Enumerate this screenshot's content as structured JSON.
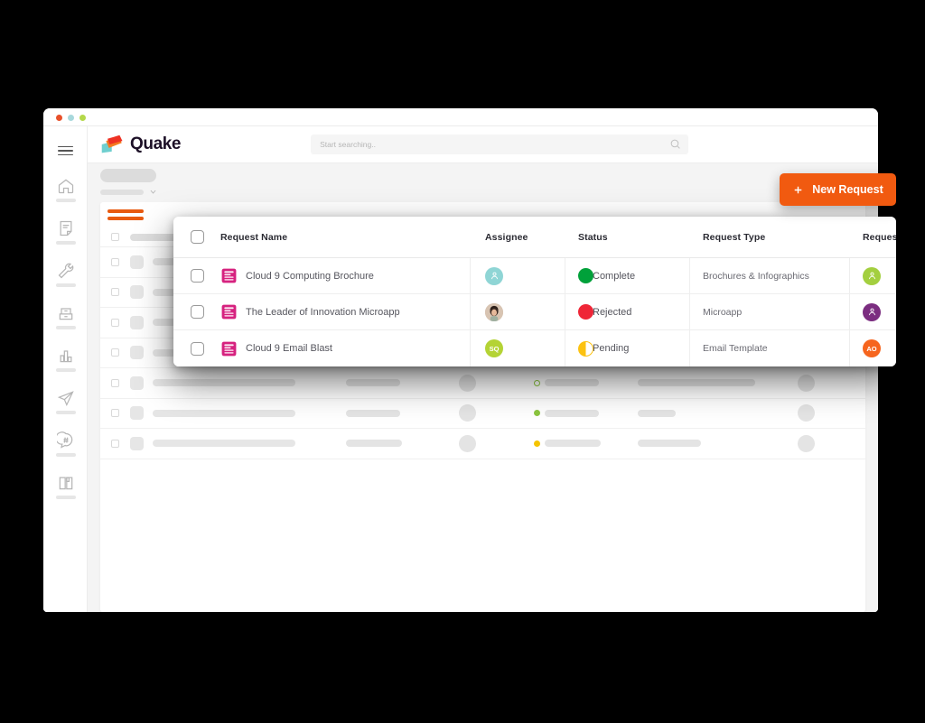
{
  "window": {
    "dots": [
      "close-dot",
      "minimize-dot",
      "maximize-dot"
    ]
  },
  "brand": {
    "name": "Quake",
    "logo_colors": {
      "red": "#ee3124",
      "orange": "#f47b20",
      "teal": "#6fcfcf"
    }
  },
  "search": {
    "placeholder": "Start searching..",
    "value": ""
  },
  "toolbar": {
    "new_request_label": "New Request",
    "new_request_color": "#f15a10",
    "plus_icon": "plus-icon"
  },
  "sidebar": {
    "items": [
      {
        "icon": "hamburger-menu-icon",
        "label": ""
      },
      {
        "icon": "home-icon",
        "label": ""
      },
      {
        "icon": "note-icon",
        "label": ""
      },
      {
        "icon": "wrench-icon",
        "label": ""
      },
      {
        "icon": "file-cabinet-icon",
        "label": ""
      },
      {
        "icon": "bar-chart-icon",
        "label": ""
      },
      {
        "icon": "paper-plane-icon",
        "label": ""
      },
      {
        "icon": "chat-bubble-icon",
        "label": ""
      },
      {
        "icon": "book-icon",
        "label": ""
      }
    ]
  },
  "table": {
    "columns": [
      "Request Name",
      "Assignee",
      "Status",
      "Request Type",
      "Requestor"
    ],
    "select_all_checkbox": "unchecked",
    "rows": [
      {
        "checkbox": "unchecked",
        "icon": "document-icon",
        "name": "Cloud 9 Computing Brochure",
        "assignee": {
          "type": "icon",
          "initials": "",
          "color": "#8fd5d5"
        },
        "status": {
          "label": "Complete",
          "color": "#00a13a",
          "fill": "full"
        },
        "request_type": "Brochures & Infographics",
        "requestor": {
          "type": "icon",
          "initials": "",
          "color": "#a3cf3f"
        }
      },
      {
        "checkbox": "unchecked",
        "icon": "document-icon",
        "name": "The Leader of Innovation Microapp",
        "assignee": {
          "type": "photo",
          "initials": "",
          "color": "#c9b6a8"
        },
        "status": {
          "label": "Rejected",
          "color": "#ef2637",
          "fill": "full"
        },
        "request_type": "Microapp",
        "requestor": {
          "type": "icon",
          "initials": "",
          "color": "#7b2d80"
        }
      },
      {
        "checkbox": "unchecked",
        "icon": "document-icon",
        "name": "Cloud 9 Email Blast",
        "assignee": {
          "type": "initials",
          "initials": "SQ",
          "color": "#b4d335"
        },
        "status": {
          "label": "Pending",
          "color": "#fcc211",
          "fill": "half"
        },
        "request_type": "Email Template",
        "requestor": {
          "type": "initials",
          "initials": "AO",
          "color": "#f6651e"
        }
      }
    ]
  },
  "skeleton": {
    "header": {
      "checkbox": "unchecked"
    },
    "rows": [
      {
        "status_dot": {
          "color": "#8cc63f",
          "style": "ring"
        },
        "name_w": 158,
        "asg_w": 62,
        "st_w": 62,
        "type_w": 98
      },
      {
        "status_dot": {
          "color": "#e8401a",
          "style": "solid"
        },
        "name_w": 155,
        "asg_w": 60,
        "st_w": 60,
        "type_w": 45
      },
      {
        "status_dot": {
          "color": "#f5c400",
          "style": "solid"
        },
        "name_w": 155,
        "asg_w": 62,
        "st_w": 62,
        "type_w": 125
      },
      {
        "status_dot": {
          "color": "#e8401a",
          "style": "solid"
        },
        "name_w": 158,
        "asg_w": 62,
        "st_w": 62,
        "type_w": 88
      },
      {
        "status_dot": {
          "color": "#8cc63f",
          "style": "ring"
        },
        "name_w": 158,
        "asg_w": 60,
        "st_w": 60,
        "type_w": 130
      },
      {
        "status_dot": {
          "color": "#8cc63f",
          "style": "solid"
        },
        "name_w": 158,
        "asg_w": 60,
        "st_w": 60,
        "type_w": 42
      },
      {
        "status_dot": {
          "color": "#f5c400",
          "style": "solid"
        },
        "name_w": 158,
        "asg_w": 62,
        "st_w": 62,
        "type_w": 70
      }
    ]
  }
}
